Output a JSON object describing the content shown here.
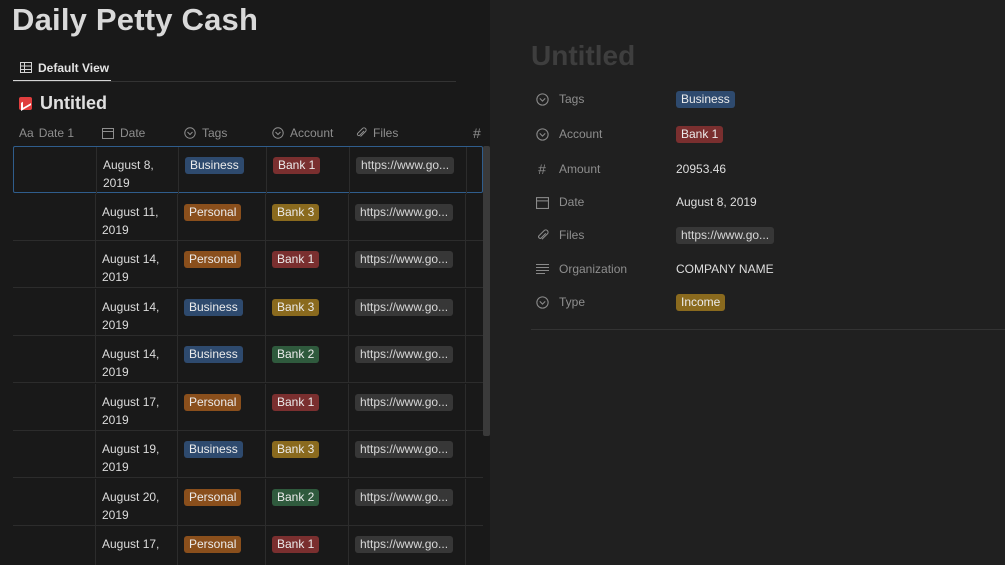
{
  "page": {
    "title": "Daily Petty Cash"
  },
  "view": {
    "tab_label": "Default View"
  },
  "database": {
    "title": "Untitled"
  },
  "columns": {
    "date1": "Date 1",
    "date": "Date",
    "tags": "Tags",
    "account": "Account",
    "files": "Files",
    "amount_glyph": "#",
    "aa": "Aa"
  },
  "rows": [
    {
      "date": "August 8, 2019",
      "tag": "Business",
      "tag_class": "business",
      "account": "Bank 1",
      "acct_class": "bank1",
      "file": "https://www.go..."
    },
    {
      "date": "August 11, 2019",
      "tag": "Personal",
      "tag_class": "personal",
      "account": "Bank 3",
      "acct_class": "bank3",
      "file": "https://www.go..."
    },
    {
      "date": "August 14, 2019",
      "tag": "Personal",
      "tag_class": "personal",
      "account": "Bank 1",
      "acct_class": "bank1",
      "file": "https://www.go..."
    },
    {
      "date": "August 14, 2019",
      "tag": "Business",
      "tag_class": "business",
      "account": "Bank 3",
      "acct_class": "bank3",
      "file": "https://www.go..."
    },
    {
      "date": "August 14, 2019",
      "tag": "Business",
      "tag_class": "business",
      "account": "Bank 2",
      "acct_class": "bank2",
      "file": "https://www.go..."
    },
    {
      "date": "August 17, 2019",
      "tag": "Personal",
      "tag_class": "personal",
      "account": "Bank 1",
      "acct_class": "bank1",
      "file": "https://www.go..."
    },
    {
      "date": "August 19, 2019",
      "tag": "Business",
      "tag_class": "business",
      "account": "Bank 3",
      "acct_class": "bank3",
      "file": "https://www.go..."
    },
    {
      "date": "August 20, 2019",
      "tag": "Personal",
      "tag_class": "personal",
      "account": "Bank 2",
      "acct_class": "bank2",
      "file": "https://www.go..."
    },
    {
      "date": "August 17,",
      "tag": "Personal",
      "tag_class": "personal",
      "account": "Bank 1",
      "acct_class": "bank1",
      "file": "https://www.go..."
    }
  ],
  "peek": {
    "title": "Untitled",
    "properties": {
      "tags": {
        "label": "Tags",
        "value": "Business"
      },
      "account": {
        "label": "Account",
        "value": "Bank 1"
      },
      "amount": {
        "label": "Amount",
        "value": "20953.46"
      },
      "date": {
        "label": "Date",
        "value": "August 8, 2019"
      },
      "files": {
        "label": "Files",
        "value": "https://www.go..."
      },
      "organization": {
        "label": "Organization",
        "value": "COMPANY NAME"
      },
      "type": {
        "label": "Type",
        "value": "Income"
      }
    }
  },
  "colors": {
    "background": "#191919",
    "peek_background": "#202020",
    "business": "#2e4a6e",
    "personal": "#8a4f1c",
    "bank1": "#7a2f2f",
    "bank2": "#2f5a3d",
    "bank3": "#8a6a1e",
    "selection": "#2f5d8c"
  }
}
